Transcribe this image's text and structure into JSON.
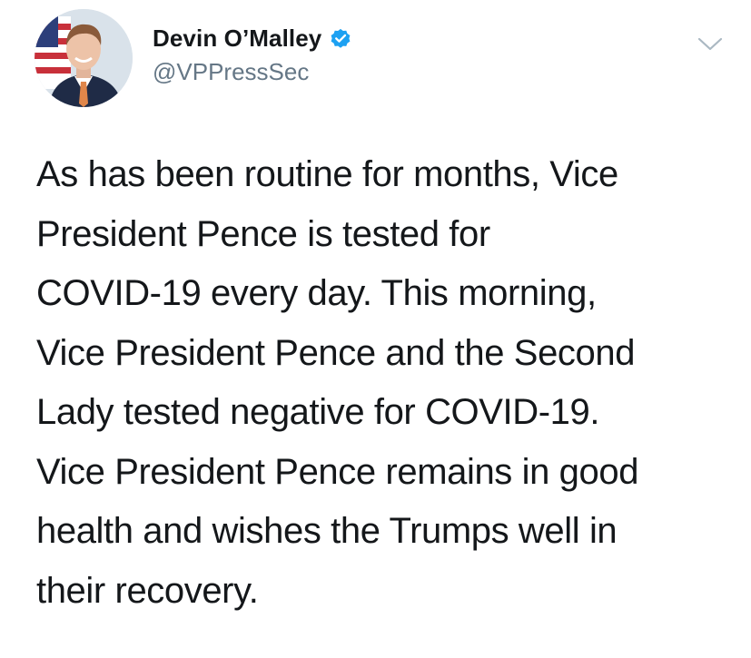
{
  "author": {
    "display_name": "Devin O’Malley",
    "handle": "@VPPressSec",
    "verified": true,
    "avatar_icon": "profile-photo"
  },
  "header": {
    "menu_icon": "chevron-down-icon",
    "verified_icon": "verified-badge-icon"
  },
  "tweet": {
    "lines": [
      "As has been routine for months, Vice",
      "President Pence is tested for",
      "COVID-19 every day. This morning,",
      "Vice President Pence and the Second",
      "Lady tested negative for COVID-19.",
      "Vice President Pence remains in good",
      "health and wishes the Trumps well in",
      "their recovery."
    ]
  },
  "colors": {
    "text": "#14171a",
    "secondary_text": "#657786",
    "verified_blue": "#1da1f2",
    "caret": "#aab8c2"
  }
}
